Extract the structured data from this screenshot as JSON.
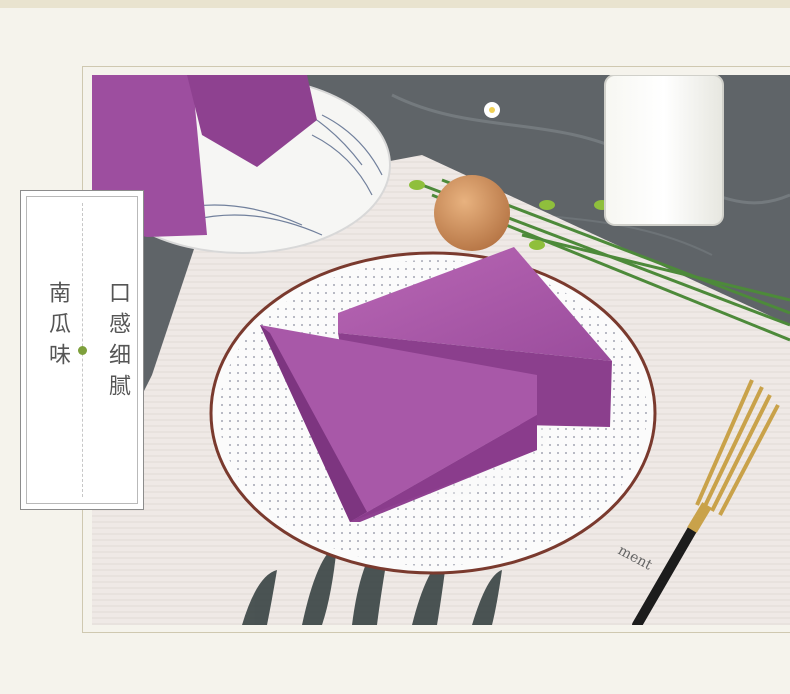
{
  "label_card": {
    "left_text": "南瓜味",
    "right_text": "口感细腻"
  },
  "photo": {
    "subject": "purple-cake-slices",
    "colors": {
      "cake": "#a14fa1",
      "cake_dark": "#7d3580",
      "plate_rim": "#7a3a2e",
      "fork_gold": "#c9a24a",
      "placemat": "#f1ece9",
      "marble": "#5f6468"
    }
  }
}
